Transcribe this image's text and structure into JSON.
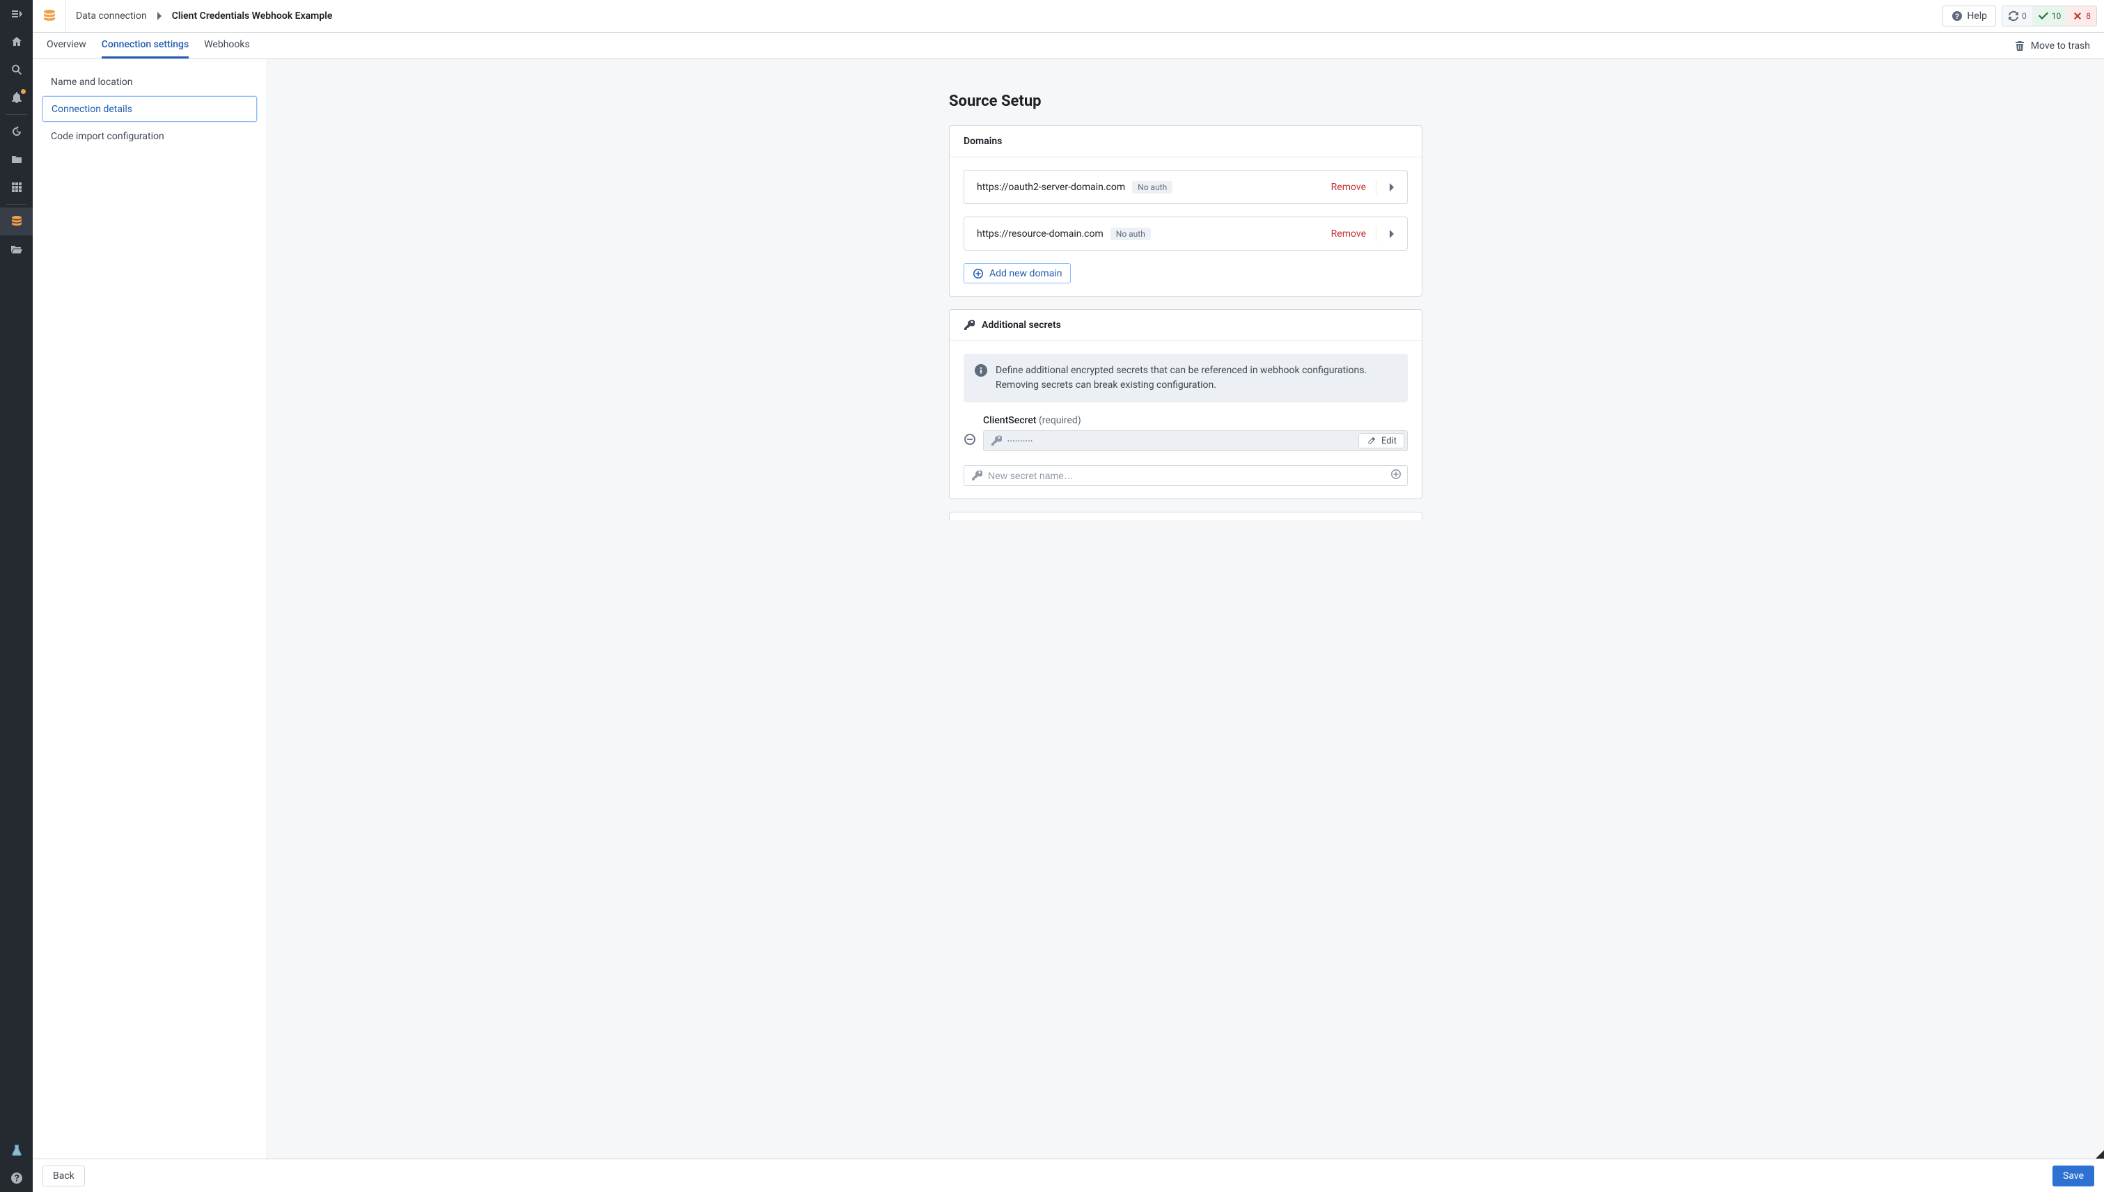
{
  "breadcrumb": {
    "parent": "Data connection",
    "current": "Client Credentials Webhook Example"
  },
  "help_label": "Help",
  "status": {
    "pending": "0",
    "ok": "10",
    "fail": "8"
  },
  "tabs": {
    "overview": "Overview",
    "settings": "Connection settings",
    "webhooks": "Webhooks"
  },
  "trash_label": "Move to trash",
  "leftnav": {
    "name_location": "Name and location",
    "connection_details": "Connection details",
    "code_import": "Code import configuration"
  },
  "page_title": "Source Setup",
  "domains": {
    "header": "Domains",
    "rows": [
      {
        "url": "https://oauth2-server-domain.com",
        "auth": "No auth",
        "remove": "Remove"
      },
      {
        "url": "https://resource-domain.com",
        "auth": "No auth",
        "remove": "Remove"
      }
    ],
    "add_label": "Add new domain"
  },
  "secrets": {
    "header": "Additional secrets",
    "info": "Define additional encrypted secrets that can be referenced in webhook configurations. Removing secrets can break existing configuration.",
    "item": {
      "name": "ClientSecret",
      "required_suffix": "(required)",
      "masked": "••••••••••",
      "edit": "Edit"
    },
    "new_placeholder": "New secret name…"
  },
  "footer": {
    "back": "Back",
    "save": "Save"
  }
}
